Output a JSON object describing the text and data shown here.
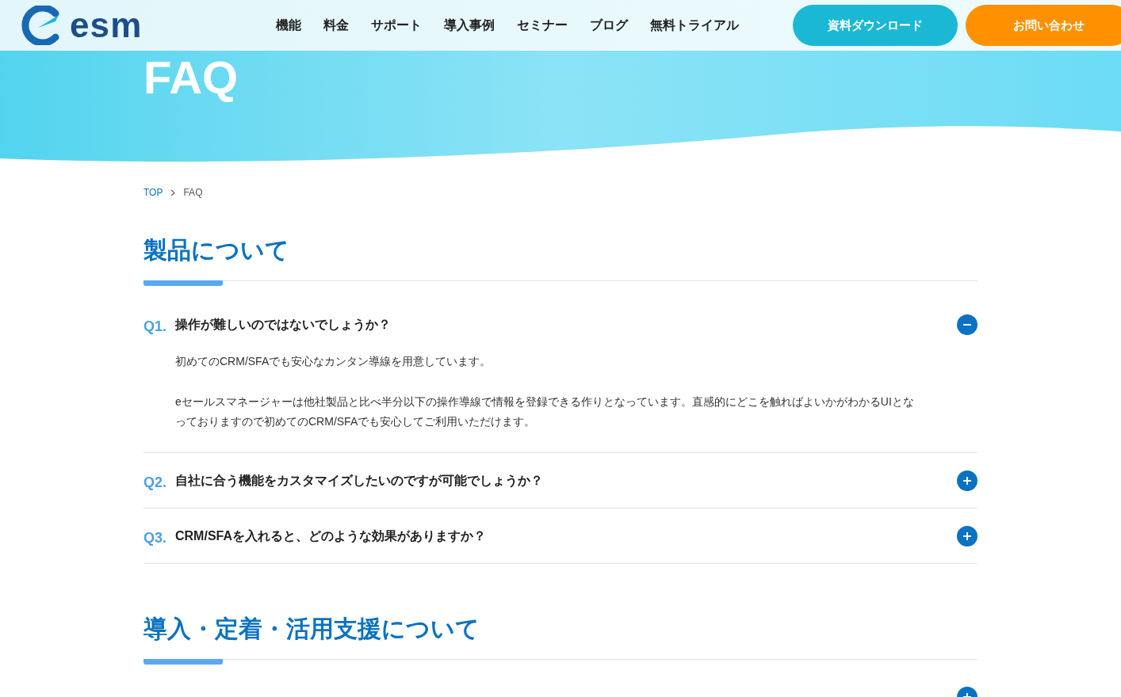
{
  "header": {
    "logo_text": "esm",
    "nav": [
      "機能",
      "料金",
      "サポート",
      "導入事例",
      "セミナー",
      "ブログ",
      "無料トライアル"
    ],
    "buttons": [
      {
        "label": "資料ダウンロード",
        "kind": "download"
      },
      {
        "label": "お問い合わせ",
        "kind": "contact"
      }
    ]
  },
  "hero": {
    "title": "FAQ"
  },
  "breadcrumb": [
    {
      "label": "TOP",
      "kind": "link"
    },
    {
      "label": "FAQ",
      "kind": "current"
    }
  ],
  "sections": [
    {
      "title": "製品について",
      "questions": [
        {
          "number": "Q1.",
          "question": "操作が難しいのではないでしょうか？",
          "expanded": true,
          "answer": [
            "初めてのCRM/SFAでも安心なカンタン導線を用意しています。",
            "eセールスマネージャーは他社製品と比べ半分以下の操作導線で情報を登録できる作りとなっています。直感的にどこを触ればよいかがわかるUIとなっておりますので初めてのCRM/SFAでも安心してご利用いただけます。"
          ]
        },
        {
          "number": "Q2.",
          "question": "自社に合う機能をカスタマイズしたいのですが可能でしょうか？",
          "expanded": false
        },
        {
          "number": "Q3.",
          "question": "CRM/SFAを入れると、どのような効果がありますか？",
          "expanded": false
        }
      ]
    },
    {
      "title": "導入・定着・活用支援について"
    }
  ]
}
